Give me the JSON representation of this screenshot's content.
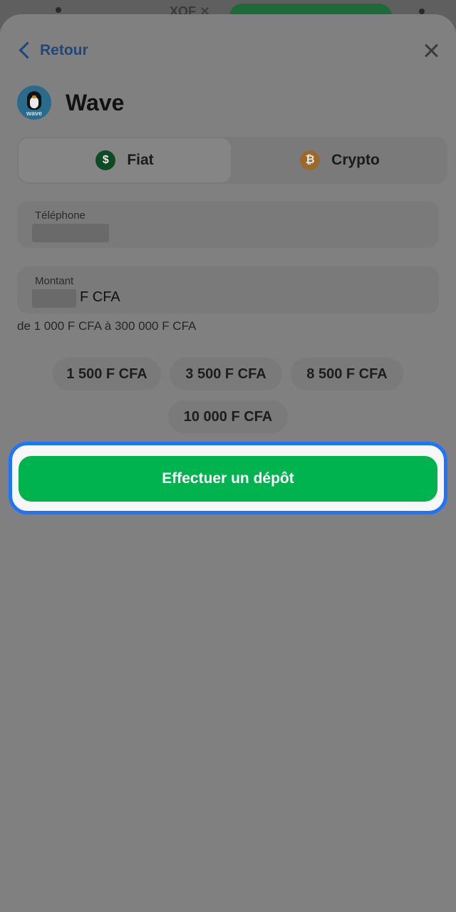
{
  "status_bar": {
    "currency_code": "XOF ✕"
  },
  "header": {
    "back_label": "Retour",
    "close_icon": "close-icon"
  },
  "provider": {
    "name": "Wave",
    "logo_text": "wave"
  },
  "tabs": [
    {
      "label": "Fiat",
      "icon": "dollar-icon",
      "selected": true
    },
    {
      "label": "Crypto",
      "icon": "bitcoin-icon",
      "selected": false
    }
  ],
  "form": {
    "phone_label": "Téléphone",
    "amount_label": "Montant",
    "amount_suffix": "F CFA",
    "range_hint": "de 1 000 F CFA à 300 000 F CFA"
  },
  "quick_amounts": [
    "1 500 F CFA",
    "3 500 F CFA",
    "8 500 F CFA",
    "10 000 F CFA"
  ],
  "cta": {
    "label": "Effectuer un dépôt"
  },
  "colors": {
    "accent_blue": "#1e73ff",
    "cta_green": "#00b34f",
    "overlay": "#808080"
  }
}
